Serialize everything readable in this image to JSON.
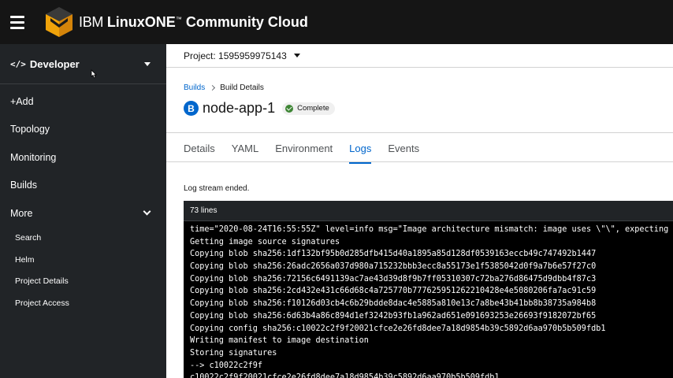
{
  "masthead": {
    "brand_ibm": "IBM ",
    "brand_linuxone": "LinuxONE",
    "brand_tm": "™",
    "brand_cc": " Community Cloud"
  },
  "sidebar": {
    "perspective": {
      "icon": "code-icon",
      "label": "Developer"
    },
    "items": [
      {
        "label": "+Add"
      },
      {
        "label": "Topology"
      },
      {
        "label": "Monitoring"
      },
      {
        "label": "Builds"
      },
      {
        "label": "More"
      }
    ],
    "more_items": [
      {
        "label": "Search"
      },
      {
        "label": "Helm"
      },
      {
        "label": "Project Details"
      },
      {
        "label": "Project Access"
      }
    ]
  },
  "project_bar": {
    "label": "Project: 1595959975143"
  },
  "breadcrumb": {
    "builds": "Builds",
    "current": "Build Details"
  },
  "title": {
    "badge": "B",
    "name": "node-app-1",
    "status": "Complete"
  },
  "tabs": [
    "Details",
    "YAML",
    "Environment",
    "Logs",
    "Events"
  ],
  "active_tab": "Logs",
  "logs": {
    "message": "Log stream ended.",
    "line_count": "73 lines",
    "lines": [
      "time=\"2020-08-24T16:55:55Z\" level=info msg=\"Image architecture mismatch: image uses \\\"\\\", expecting",
      "Getting image source signatures",
      "Copying blob sha256:1df132bf95b0d285dfb415d40a1895a85d128df0539163eccb49c747492b1447",
      "Copying blob sha256:26adc2656a037d980a715232bbb3ecc8a55173e1f5385042d0f9a7b6e57f27c0",
      "Copying blob sha256:72156c6491139ac7ae43d39d8f9b7ff05310307c72ba276d86475d9dbb4f87c3",
      "Copying blob sha256:2cd432e431c66d68c4a725770b777625951262210428e4e5080206fa7ac91c59",
      "Copying blob sha256:f10126d03cb4c6b29bdde8dac4e5885a810e13c7a8be43b41bb8b38735a984b8",
      "Copying blob sha256:6d63b4a86c894d1ef3242b93fb1a962ad651e091693253e26693f9182072bf65",
      "Copying config sha256:c10022c2f9f20021cfce2e26fd8dee7a18d9854b39c5892d6aa970b5b509fdb1",
      "Writing manifest to image destination",
      "Storing signatures",
      "--> c10022c2f9f",
      "c10022c2f9f20021cfce2e26fd8dee7a18d9854b39c5892d6aa970b5b509fdb1"
    ]
  }
}
